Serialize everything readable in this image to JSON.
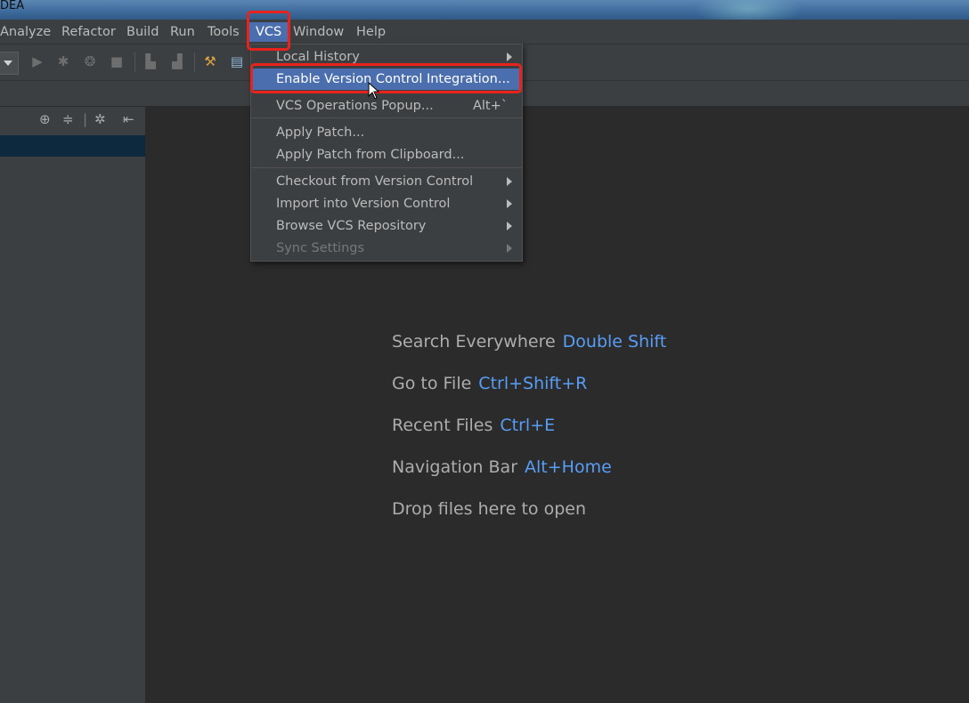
{
  "window": {
    "title": "DEA"
  },
  "menubar": {
    "items": [
      "Analyze",
      "Refactor",
      "Build",
      "Run",
      "Tools",
      "VCS",
      "Window",
      "Help"
    ],
    "active": "VCS"
  },
  "vcs_menu": {
    "local_history": "Local History",
    "enable_vci": "Enable Version Control Integration...",
    "vcs_operations_popup": "VCS Operations Popup...",
    "vcs_operations_popup_shortcut": "Alt+`",
    "apply_patch": "Apply Patch...",
    "apply_patch_clipboard": "Apply Patch from Clipboard...",
    "checkout": "Checkout from Version Control",
    "import": "Import into Version Control",
    "browse": "Browse VCS Repository",
    "sync": "Sync Settings"
  },
  "welcome": {
    "search_label": "Search Everywhere",
    "search_key": "Double Shift",
    "goto_label": "Go to File",
    "goto_key": "Ctrl+Shift+R",
    "recent_label": "Recent Files",
    "recent_key": "Ctrl+E",
    "navbar_label": "Navigation Bar",
    "navbar_key": "Alt+Home",
    "drop_label": "Drop files here to open"
  },
  "colors": {
    "selection": "#4b6eaf",
    "highlight_box": "#e8231e",
    "shortcut": "#589df6"
  }
}
